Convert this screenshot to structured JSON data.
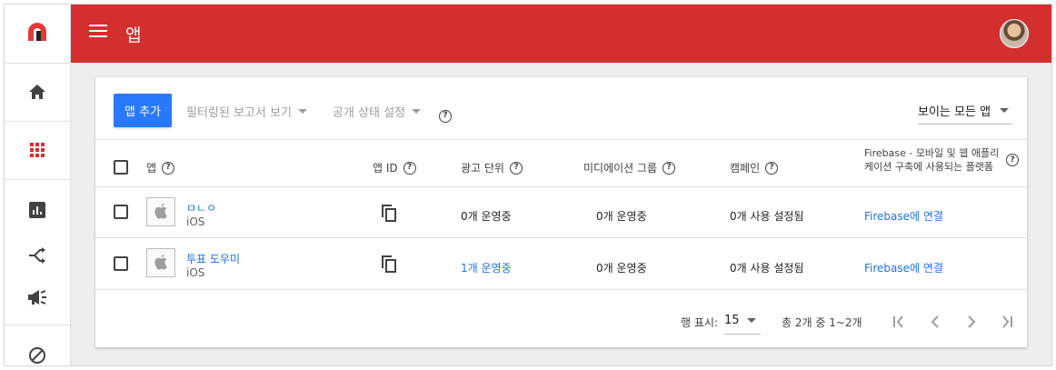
{
  "header": {
    "title": "앱"
  },
  "rail": {
    "items": [
      {
        "icon": "logo-icon"
      },
      {
        "icon": "home-icon"
      },
      {
        "icon": "apps-grid-icon"
      },
      {
        "icon": "reports-icon"
      },
      {
        "icon": "mediation-icon"
      },
      {
        "icon": "campaigns-icon"
      },
      {
        "icon": "blocking-icon"
      }
    ]
  },
  "toolbar": {
    "add_app": "앱 추가",
    "filter_reports": "필터링된 보고서 보기",
    "set_status": "공개 상태 설정",
    "visible_apps": "보이는 모든 앱"
  },
  "table": {
    "headers": {
      "app": "앱",
      "app_id": "앱 ID",
      "ad_units": "광고 단위",
      "mediation": "미디에이션 그룹",
      "campaigns": "캠페인",
      "firebase": "Firebase - 모바일 및 웹 애플리케이션 구축에 사용되는 플랫폼"
    },
    "rows": [
      {
        "name": "ㅁㄴㅇ",
        "platform": "iOS",
        "ad_units": "0개 운영중",
        "mediation": "0개 운영중",
        "campaigns": "0개 사용 설정됨",
        "firebase": "Firebase에 연결"
      },
      {
        "name": "투표 도우미",
        "platform": "iOS",
        "ad_units": "1개 운영중",
        "mediation": "0개 운영중",
        "campaigns": "0개 사용 설정됨",
        "firebase": "Firebase에 연결"
      }
    ]
  },
  "pagination": {
    "rows_label": "행 표시:",
    "rows_value": "15",
    "range": "총 2개 중 1~2개"
  },
  "colors": {
    "brand": "#d32f2f",
    "accent": "#2979ff",
    "link": "#1a73e8"
  }
}
